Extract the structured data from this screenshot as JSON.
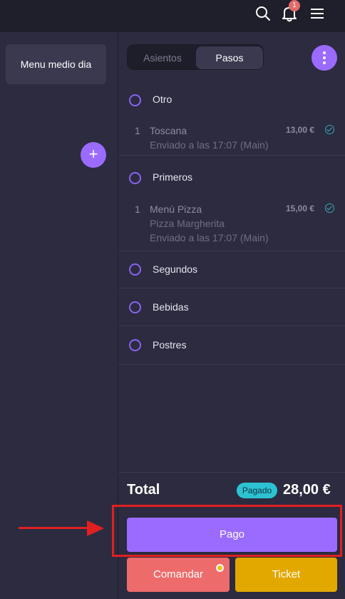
{
  "topbar": {
    "notification_count": "1",
    "icons": [
      "search-icon",
      "bell-icon",
      "hamburger-menu-icon"
    ]
  },
  "left": {
    "menu_card_label": "Menu medio dia",
    "add_label": "+"
  },
  "tabs": {
    "asientos": "Asientos",
    "pasos": "Pasos",
    "selected": "Pasos"
  },
  "groups": {
    "otro": "Otro",
    "primeros": "Primeros",
    "segundos": "Segundos",
    "bebidas": "Bebidas",
    "postres": "Postres"
  },
  "items": [
    {
      "qty": "1",
      "name": "Toscana",
      "sub": "",
      "sent": "Enviado a las 17:07 (Main)",
      "price": "13,00 €"
    },
    {
      "qty": "1",
      "name": "Menú Pizza",
      "sub": "Pizza Margherita",
      "sent": "Enviado a las 17:07 (Main)",
      "price": "15,00 €"
    }
  ],
  "footer": {
    "total_label": "Total",
    "paid_badge": "Pagado",
    "total_value": "28,00 €",
    "pago_button": "Pago",
    "comandar_button": "Comandar",
    "ticket_button": "Ticket"
  },
  "colors": {
    "accent": "#9b6bff",
    "comandar": "#ee6b6b",
    "ticket": "#e2a800",
    "paid": "#2cc2d1",
    "annotation": "#e02020"
  }
}
